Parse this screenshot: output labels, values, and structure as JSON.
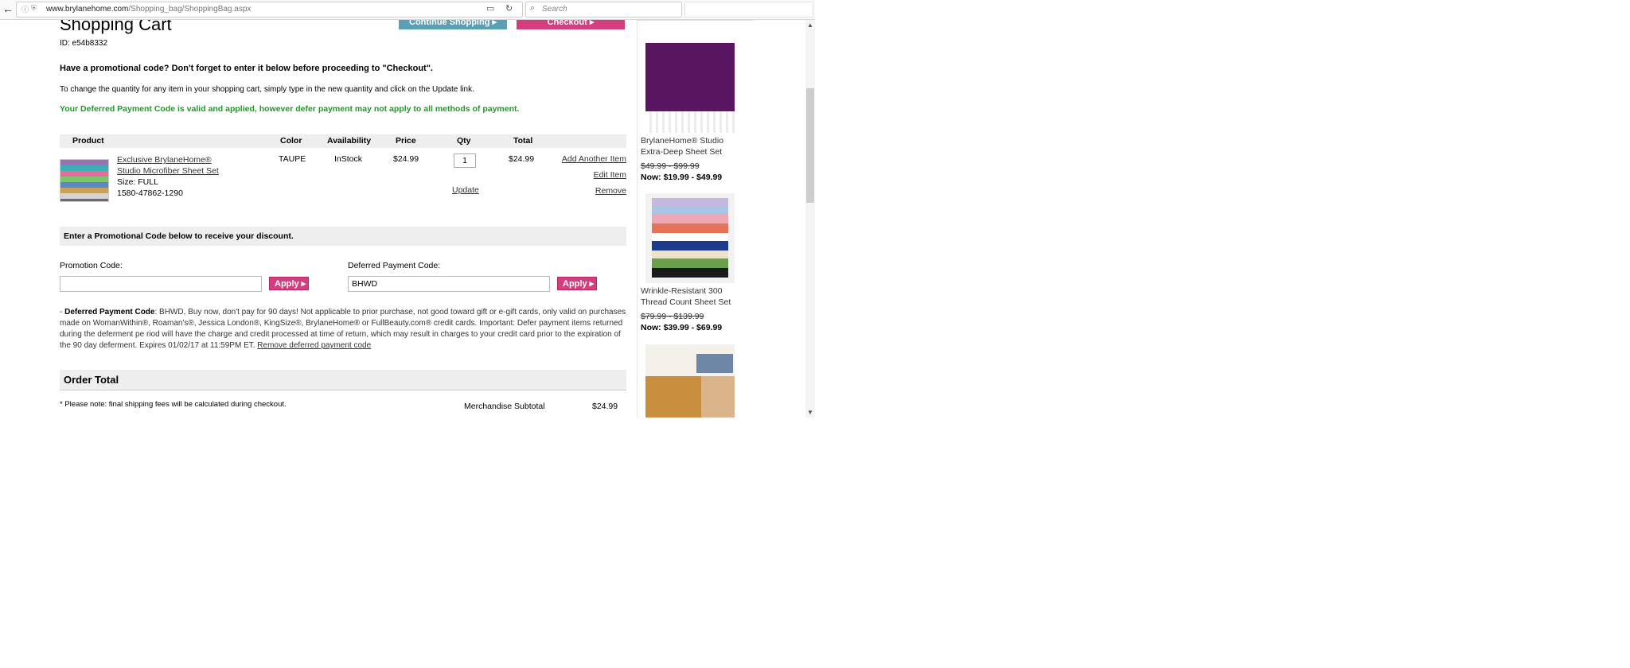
{
  "browser": {
    "url_domain": "www.brylanehome.com",
    "url_path": "/Shopping_bag/ShoppingBag.aspx",
    "search_placeholder": "Search"
  },
  "header": {
    "title": "Shopping Cart",
    "continue_label": "Continue Shopping ▸",
    "checkout_label": "Checkout ▸",
    "cart_id": "ID: e54b8332"
  },
  "messages": {
    "promo_hint": "Have a promotional code? Don't forget to enter it below before proceeding to \"Checkout\".",
    "qty_hint": "To change the quantity for any item in your shopping cart, simply type in the new quantity and click on the Update link.",
    "deferred_ok": "Your Deferred Payment Code is valid and applied, however defer payment may not apply to all methods of payment."
  },
  "table": {
    "headers": [
      "Product",
      "Color",
      "Availability",
      "Price",
      "Qty",
      "Total"
    ],
    "item": {
      "name": "Exclusive BrylaneHome® Studio Microfiber Sheet Set",
      "size": "Size: FULL",
      "sku": "1580-47862-1290",
      "color": "TAUPE",
      "availability": "InStock",
      "price": "$24.99",
      "qty": "1",
      "update": "Update",
      "total": "$24.99",
      "add_another": "Add Another Item",
      "edit": "Edit Item",
      "remove": "Remove"
    }
  },
  "promo": {
    "bar_title": "Enter a Promotional Code below to receive your discount.",
    "promo_label": "Promotion Code:",
    "promo_value": "",
    "deferred_label": "Deferred Payment Code:",
    "deferred_value": "BHWD",
    "apply_label": "Apply ▸"
  },
  "deferred_note": {
    "prefix": "- ",
    "bold": "Deferred Payment Code",
    "text": ": BHWD, Buy now, don't pay for 90 days! Not applicable to prior purchase, not good toward gift or e-gift cards, only valid on purchases made on WomanWithin®, Roaman's®, Jessica London®, KingSize®, BrylaneHome® or FullBeauty.com® credit cards. Important: Defer payment items returned during the deferment pe riod will have the charge and credit processed at time of return, which may result in charges to your credit card prior to the expiration of the 90 day deferment. Expires 01/02/17 at 11:59PM ET. ",
    "link": "Remove deferred payment code"
  },
  "order": {
    "title": "Order Total",
    "ship_note": "* Please note: final shipping fees will be calculated during checkout.",
    "subtotal_label": "Merchandise Subtotal",
    "subtotal_value": "$24.99"
  },
  "recommendations": [
    {
      "name": "BrylaneHome® Studio Extra-Deep Sheet Set",
      "old_price": "$49.99 - $99.99",
      "now_price": "Now: $19.99 - $49.99"
    },
    {
      "name": "Wrinkle-Resistant 300 Thread Count Sheet Set",
      "old_price": "$79.99 - $139.99",
      "now_price": "Now: $39.99 - $69.99"
    }
  ],
  "colors": {
    "accent_pink": "#d43d7e",
    "accent_teal": "#5b9fb5",
    "success_green": "#1e9a25"
  }
}
